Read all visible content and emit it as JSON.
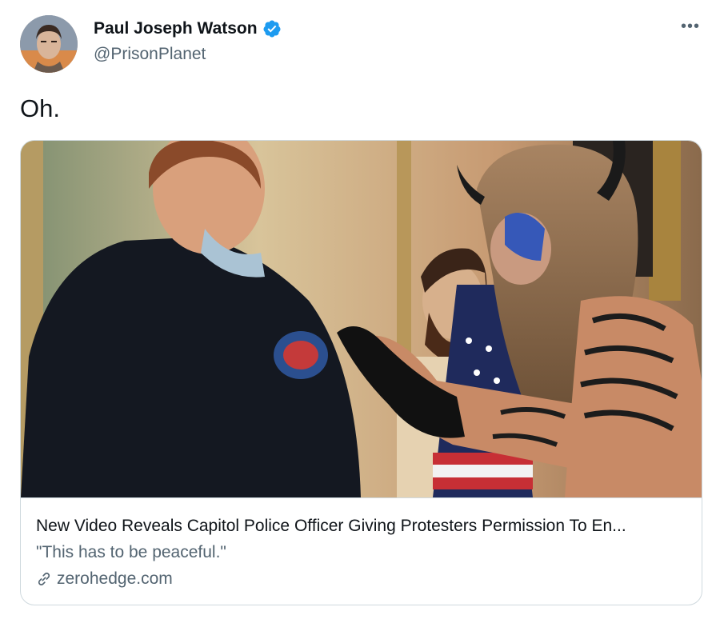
{
  "author": {
    "display_name": "Paul Joseph Watson",
    "handle": "@PrisonPlanet",
    "verified": true
  },
  "tweet": {
    "text": "Oh."
  },
  "card": {
    "title": "New Video Reveals Capitol Police Officer Giving Protesters Permission To En...",
    "description": "\"This has to be peaceful.\"",
    "domain": "zerohedge.com"
  },
  "menu": {
    "more_label": "•••"
  },
  "colors": {
    "verified": "#1d9bf0",
    "secondary_text": "#536471",
    "border": "#cfd9de"
  }
}
